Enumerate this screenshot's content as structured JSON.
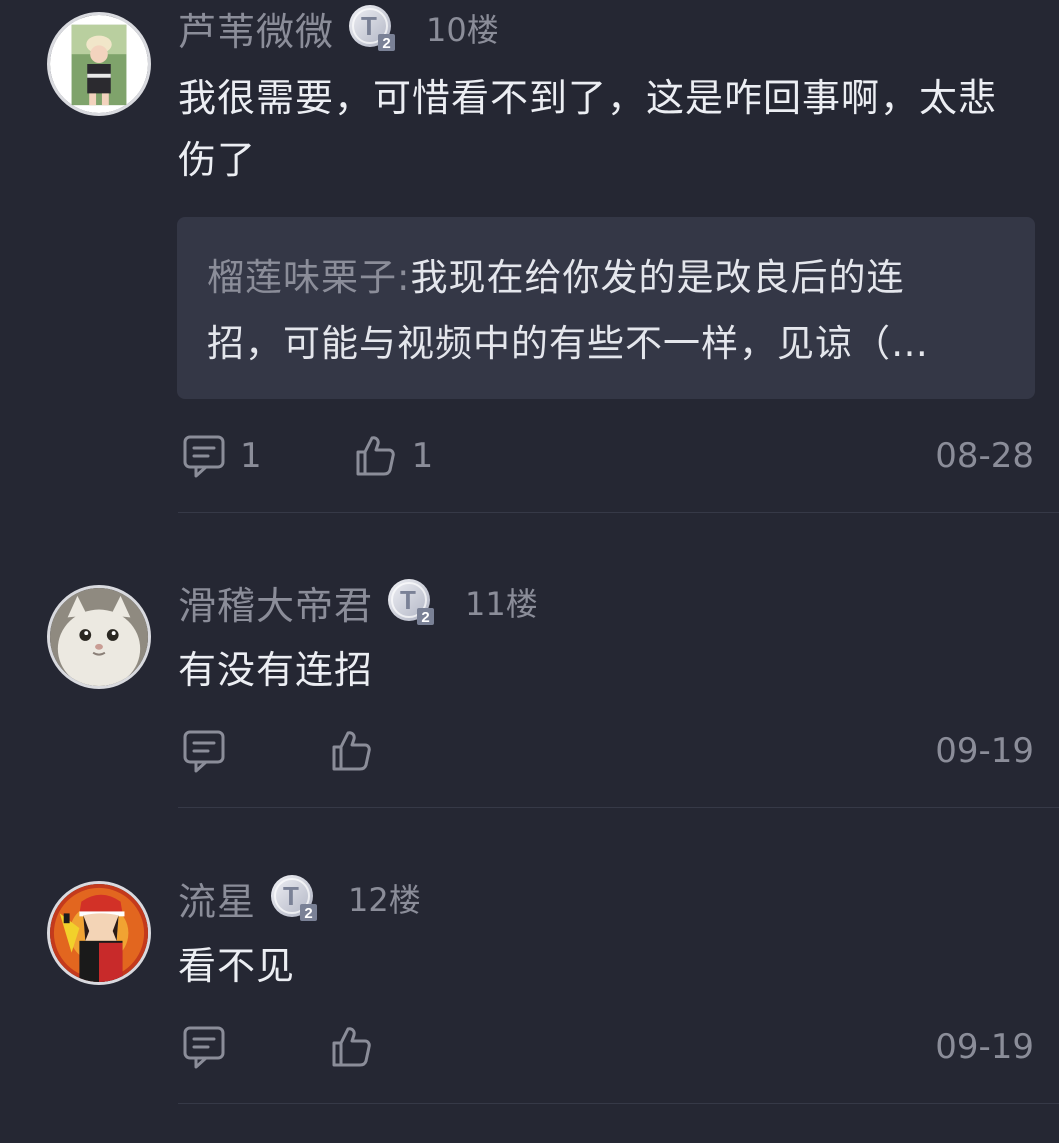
{
  "comments": [
    {
      "username": "芦苇微微",
      "level_icon": "T2-level-badge",
      "floor": "10楼",
      "text": "我很需要，可惜看不到了，这是咋回事啊，太悲伤了",
      "reply": {
        "author": "榴莲味栗子",
        "separator": ":",
        "text_line1": "我现在给你发的是改良后的连",
        "text_line2": "招，可能与视频中的有些不一样，见谅（…"
      },
      "reply_count": "1",
      "like_count": "1",
      "date": "08-28"
    },
    {
      "username": "滑稽大帝君",
      "level_icon": "T2-level-badge",
      "floor": "11楼",
      "text": "有没有连招",
      "reply_count": "",
      "like_count": "",
      "date": "09-19"
    },
    {
      "username": "流星",
      "level_icon": "T2-level-badge",
      "floor": "12楼",
      "text": "看不见",
      "reply_count": "",
      "like_count": "",
      "date": "09-19"
    }
  ],
  "colors": {
    "background": "#252733",
    "reply_box": "#343746",
    "muted_text": "#8b8d99",
    "body_text": "#eceef3"
  }
}
